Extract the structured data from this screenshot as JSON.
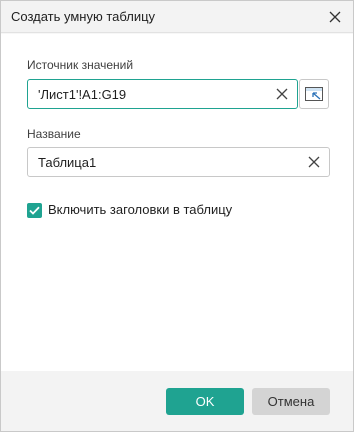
{
  "window": {
    "title": "Создать умную таблицу"
  },
  "source": {
    "label": "Источник значений",
    "value": "'Лист1'!A1:G19"
  },
  "name": {
    "label": "Название",
    "value": "Таблица1"
  },
  "headers_option": {
    "label": "Включить заголовки в таблицу",
    "checked": true
  },
  "buttons": {
    "ok": "OK",
    "cancel": "Отмена"
  },
  "colors": {
    "accent": "#1fa391",
    "cancel_bg": "#d4d4d4"
  },
  "icons": [
    "close-icon",
    "clear-icon",
    "select-range-icon",
    "checkmark-icon"
  ]
}
